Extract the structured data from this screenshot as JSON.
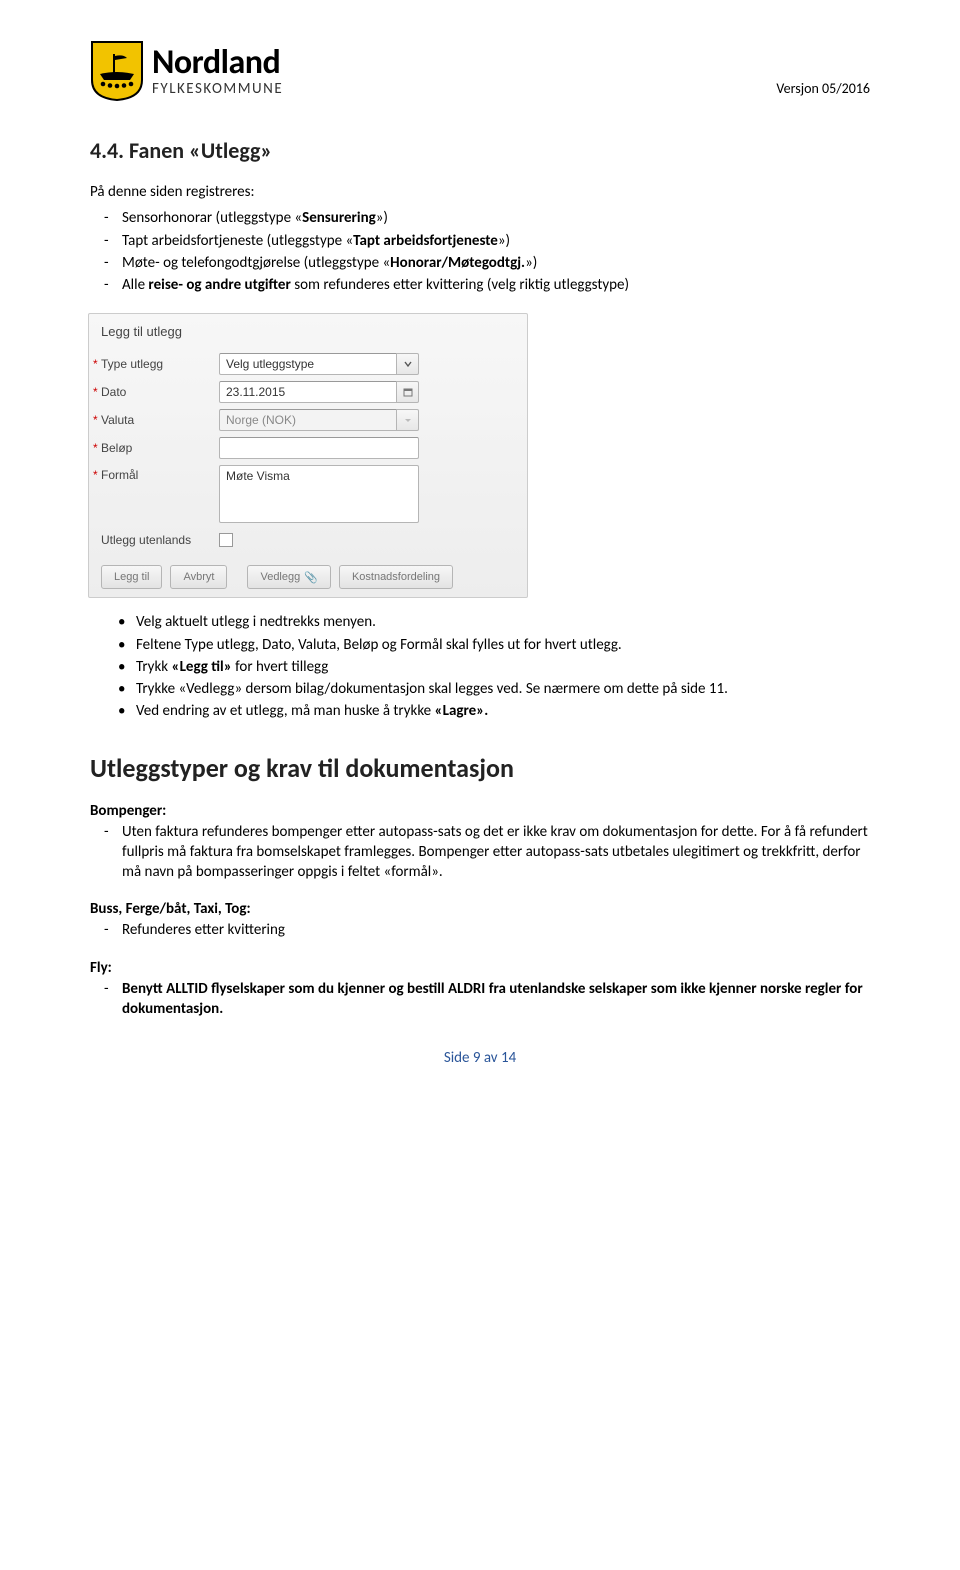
{
  "header": {
    "brand_name": "Nordland",
    "brand_sub": "FYLKESKOMMUNE",
    "version": "Versjon 05/2016"
  },
  "section": {
    "title": "4.4.  Fanen «Utlegg»",
    "intro": "På denne siden registreres:",
    "bullets": [
      {
        "pre": "Sensorhonorar (utleggstype «",
        "b": "Sensurering",
        "post": "»)"
      },
      {
        "pre": "Tapt arbeidsfortjeneste (utleggstype «",
        "b": "Tapt arbeidsfortjeneste",
        "post": "»)"
      },
      {
        "pre": "Møte- og telefongodtgjørelse (utleggstype «",
        "b": "Honorar/Møtegodtgj.",
        "post": "»)"
      },
      {
        "pre": "Alle ",
        "b": "reise- og andre utgifter",
        "post": " som refunderes etter kvittering (velg riktig utleggstype)"
      }
    ]
  },
  "form": {
    "title": "Legg til utlegg",
    "labels": {
      "type": "Type utlegg",
      "dato": "Dato",
      "valuta": "Valuta",
      "belop": "Beløp",
      "formal": "Formål",
      "utenlands": "Utlegg utenlands"
    },
    "values": {
      "type": "Velg utleggstype",
      "dato": "23.11.2015",
      "valuta": "Norge (NOK)",
      "belop": "",
      "formal": "Møte Visma"
    },
    "buttons": {
      "legg_til": "Legg til",
      "avbryt": "Avbryt",
      "vedlegg": "Vedlegg",
      "kostnad": "Kostnadsfordeling"
    }
  },
  "dot_bullets": [
    "Velg aktuelt utlegg i nedtrekks menyen.",
    "Feltene Type utlegg, Dato, Valuta, Beløp og Formål skal fylles ut for hvert utlegg.",
    "Trykk «Legg til» for hvert tillegg",
    "Trykke «Vedlegg» dersom bilag/dokumentasjon skal legges ved. Se nærmere om dette på side 11.",
    "Ved endring av et utlegg, må man huske å trykke «Lagre»."
  ],
  "dot_bold": {
    "2": "«Legg til»",
    "4": "«Lagre»."
  },
  "section2": {
    "title": "Utleggstyper og krav til dokumentasjon",
    "groups": [
      {
        "h": "Bompenger:",
        "items": [
          "Uten faktura refunderes bompenger etter autopass-sats og det er ikke krav om dokumentasjon for dette.  For å få refundert fullpris må faktura fra bomselskapet framlegges. Bompenger etter autopass-sats utbetales ulegitimert og trekkfritt, derfor må navn på bompasseringer oppgis i feltet «formål»."
        ]
      },
      {
        "h": "Buss, Ferge/båt, Taxi, Tog:",
        "items": [
          "Refunderes etter kvittering"
        ]
      },
      {
        "h": "Fly:",
        "items": [
          "Benytt ALLTID flyselskaper som du kjenner og bestill ALDRI fra utenlandske selskaper som ikke kjenner norske regler for dokumentasjon."
        ],
        "bold": true
      }
    ]
  },
  "footer": "Side 9 av 14"
}
